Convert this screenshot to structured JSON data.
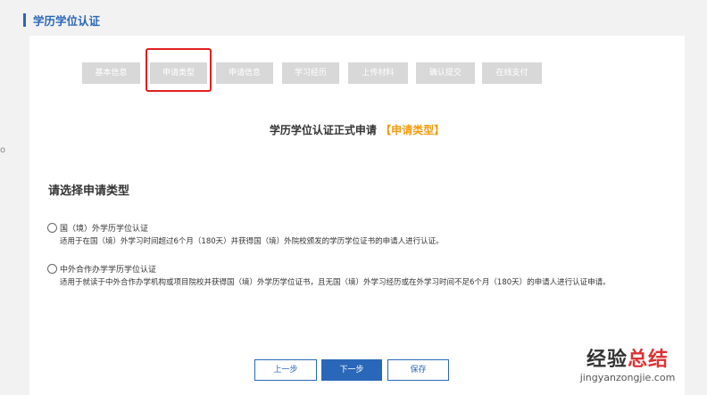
{
  "page": {
    "title": "学历学位认证",
    "left_mark": "o"
  },
  "steps": [
    {
      "label": "基本信息"
    },
    {
      "label": "申请类型"
    },
    {
      "label": "申请信息"
    },
    {
      "label": "学习经历"
    },
    {
      "label": "上传材料"
    },
    {
      "label": "确认提交"
    },
    {
      "label": "在线支付"
    }
  ],
  "active_step": "申请类型",
  "form": {
    "title": "学历学位认证正式申请",
    "title_suffix": "【申请类型】",
    "section_heading": "请选择申请类型",
    "options": [
      {
        "label": "国（境）外学历学位认证",
        "description": "适用于在国（境）外学习时间超过6个月（180天）并获得国（境）外院校颁发的学历学位证书的申请人进行认证。",
        "selected": false
      },
      {
        "label": "中外合作办学学历学位认证",
        "description": "适用于就读于中外合作办学机构或项目院校并获得国（境）外学历学位证书，且无国（境）外学习经历或在外学习时间不足6个月（180天）的申请人进行认证申请。",
        "selected": false
      }
    ]
  },
  "buttons": {
    "prev": "上一步",
    "next": "下一步",
    "save": "保存"
  },
  "watermark": {
    "top_a": "经验",
    "top_b": "总结",
    "bottom": "jingyanzongjie.com"
  },
  "colors": {
    "accent": "#2a67b8",
    "highlight": "#e02020",
    "suffix": "#f39c12",
    "step_bg": "#d8d8d8"
  }
}
